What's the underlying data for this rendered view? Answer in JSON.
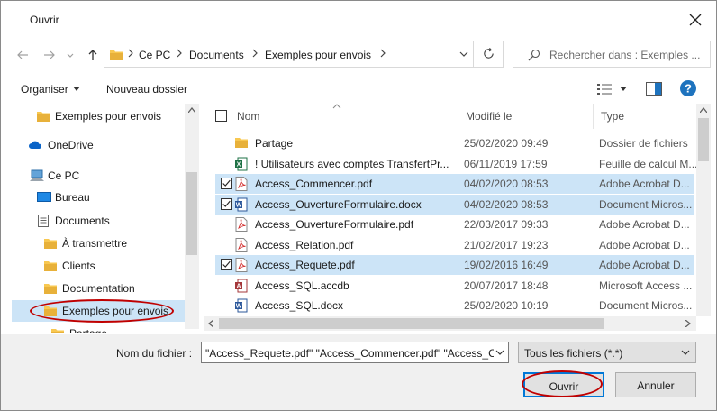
{
  "window": {
    "title": "Ouvrir"
  },
  "address": {
    "crumbs": [
      "Ce PC",
      "Documents",
      "Exemples pour envois"
    ]
  },
  "search": {
    "placeholder": "Rechercher dans : Exemples ..."
  },
  "commands": {
    "organize": "Organiser",
    "new_folder": "Nouveau dossier"
  },
  "tree": [
    {
      "label": "Exemples pour envois",
      "icon": "folder-icon"
    },
    {
      "label": "OneDrive",
      "icon": "cloud-icon"
    },
    {
      "label": "Ce PC",
      "icon": "computer-icon"
    },
    {
      "label": "Bureau",
      "icon": "desktop-icon"
    },
    {
      "label": "Documents",
      "icon": "document-icon"
    },
    {
      "label": "À transmettre",
      "icon": "folder-icon"
    },
    {
      "label": "Clients",
      "icon": "folder-icon"
    },
    {
      "label": "Documentation",
      "icon": "folder-icon"
    },
    {
      "label": "Exemples pour envois",
      "icon": "folder-icon"
    },
    {
      "label": "Partage",
      "icon": "folder-icon"
    }
  ],
  "columns": {
    "name": "Nom",
    "modified": "Modifié le",
    "type": "Type"
  },
  "files": [
    {
      "name": "Partage",
      "modified": "25/02/2020 09:49",
      "type": "Dossier de fichiers",
      "icon": "folder-icon",
      "selected": false
    },
    {
      "name": "! Utilisateurs avec comptes TransfertPr...",
      "modified": "06/11/2019 17:59",
      "type": "Feuille de calcul M...",
      "icon": "excel-icon",
      "selected": false
    },
    {
      "name": "Access_Commencer.pdf",
      "modified": "04/02/2020 08:53",
      "type": "Adobe Acrobat D...",
      "icon": "pdf-icon",
      "selected": true
    },
    {
      "name": "Access_OuvertureFormulaire.docx",
      "modified": "04/02/2020 08:53",
      "type": "Document Micros...",
      "icon": "word-icon",
      "selected": true
    },
    {
      "name": "Access_OuvertureFormulaire.pdf",
      "modified": "22/03/2017 09:33",
      "type": "Adobe Acrobat D...",
      "icon": "pdf-icon",
      "selected": false
    },
    {
      "name": "Access_Relation.pdf",
      "modified": "21/02/2017 19:23",
      "type": "Adobe Acrobat D...",
      "icon": "pdf-icon",
      "selected": false
    },
    {
      "name": "Access_Requete.pdf",
      "modified": "19/02/2016 16:49",
      "type": "Adobe Acrobat D...",
      "icon": "pdf-icon",
      "selected": true
    },
    {
      "name": "Access_SQL.accdb",
      "modified": "20/07/2017 18:48",
      "type": "Microsoft Access ...",
      "icon": "access-icon",
      "selected": false
    },
    {
      "name": "Access_SQL.docx",
      "modified": "25/02/2020 10:19",
      "type": "Document Micros...",
      "icon": "word-icon",
      "selected": false
    }
  ],
  "footer": {
    "filename_label": "Nom du fichier :",
    "filename_value": "\"Access_Requete.pdf\" \"Access_Commencer.pdf\" \"Access_C",
    "filetype": "Tous les fichiers (*.*)",
    "open": "Ouvrir",
    "cancel": "Annuler"
  },
  "colors": {
    "selection": "#cce4f7",
    "accent": "#0078d7",
    "annotation": "#c00000"
  }
}
